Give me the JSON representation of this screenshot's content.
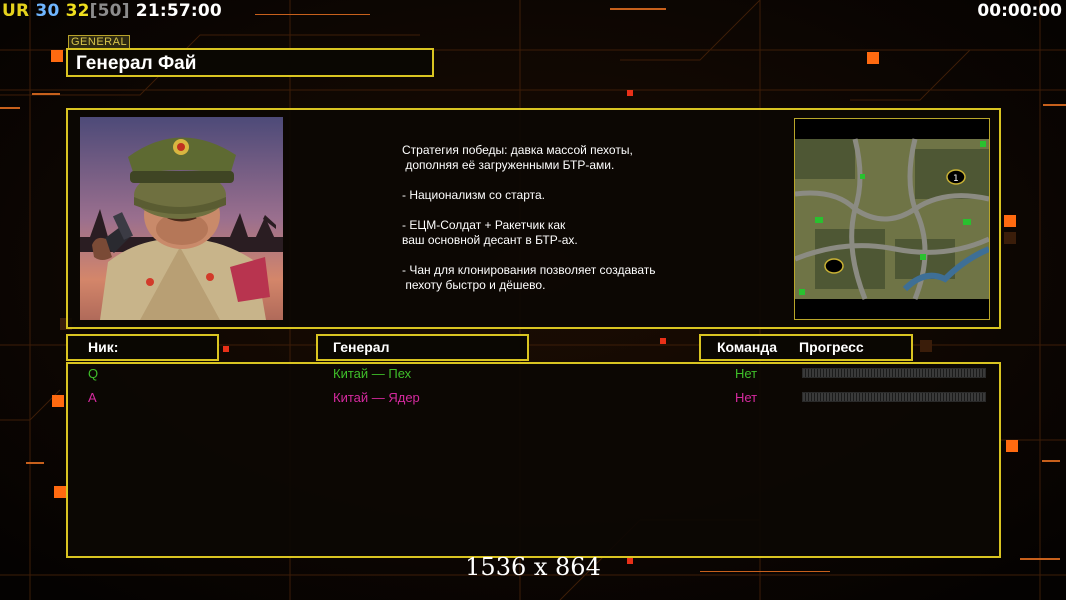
{
  "hud": {
    "ur": "UR",
    "n1": "30",
    "n2": "32",
    "n3": "[50]",
    "clock": "21:57:00",
    "timer": "00:00:00"
  },
  "general_tag": "GENERAL",
  "general_name": "Генерал Фай",
  "description": [
    "Стратегия победы: давка массой пехоты,",
    " дополняя её загруженными БТР-ами.",
    "",
    "- Национализм со старта.",
    "",
    "- ЕЦМ-Солдат + Ракетчик как",
    "ваш основной десант в БТР-ах.",
    "",
    "- Чан для клонирования позволяет создавать",
    " пехоту быстро и дёшево."
  ],
  "headers": {
    "nick": "Ник:",
    "general": "Генерал",
    "team": "Команда",
    "progress": "Прогресс"
  },
  "players": [
    {
      "nick": "Q",
      "general": "Китай — Пех",
      "team": "Нет",
      "color": "#3fbf2a"
    },
    {
      "nick": "A",
      "general": "Китай — Ядер",
      "team": "Нет",
      "color": "#d62a9f"
    }
  ],
  "resolution": "1536 x 864",
  "colors": {
    "panel_border": "#d9c421",
    "hud_ur": "#e5d21d",
    "hud_n1": "#6fb6ff",
    "hud_n2": "#f0df1e",
    "hud_n3": "#8c8c8c"
  }
}
